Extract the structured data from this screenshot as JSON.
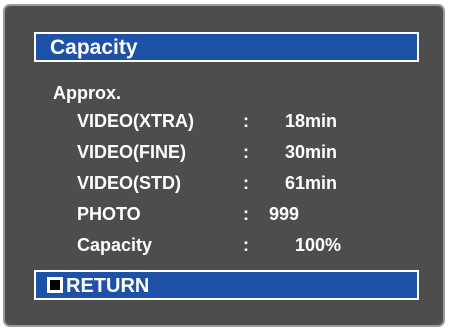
{
  "screen": {
    "title": "Capacity",
    "subtitle": "Approx.",
    "separator": ":",
    "rows": [
      {
        "label": "VIDEO(XTRA)",
        "value": "18min"
      },
      {
        "label": "VIDEO(FINE)",
        "value": "30min"
      },
      {
        "label": "VIDEO(STD)",
        "value": "61min"
      },
      {
        "label": "PHOTO",
        "value": "999"
      },
      {
        "label": "Capacity",
        "value": "100%"
      }
    ],
    "return_label": "RETURN",
    "return_icon": "stop-square-icon"
  },
  "colors": {
    "background": "#4d4d4d",
    "bar": "#1d52a8",
    "text": "#ffffff",
    "frame_border": "#999999"
  }
}
